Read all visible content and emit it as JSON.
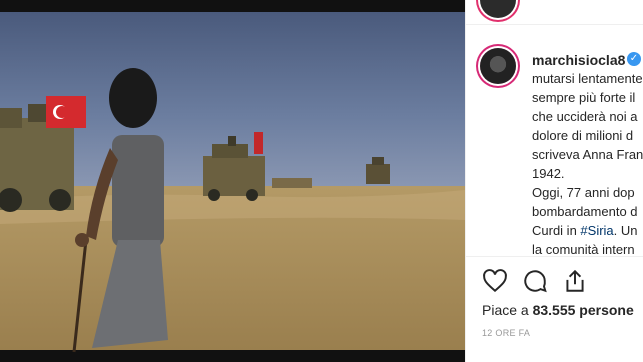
{
  "post": {
    "username": "marchisiocla8",
    "verified_icon": "verified-badge-icon",
    "caption_lines": [
      "mutarsi lentamente",
      "sempre più forte il",
      "che ucciderà noi a",
      "dolore di milioni d",
      "scriveva Anna Fran",
      "1942.",
      "Oggi, 77 anni dop",
      "bombardamento d",
      "Curdi in ",
      "la comunità intern"
    ],
    "caption_tag": "#Siria",
    "caption_tail": ". Un",
    "likes_prefix": "Piace a ",
    "likes_count": "83.555",
    "likes_suffix": " persone",
    "timestamp": "12 ORE FA"
  },
  "icons": {
    "like": "heart-icon",
    "comment": "comment-icon",
    "share": "share-icon"
  },
  "colors": {
    "accent": "#3897f0",
    "story_ring": "#d62976",
    "text": "#262626",
    "muted": "#999999"
  }
}
